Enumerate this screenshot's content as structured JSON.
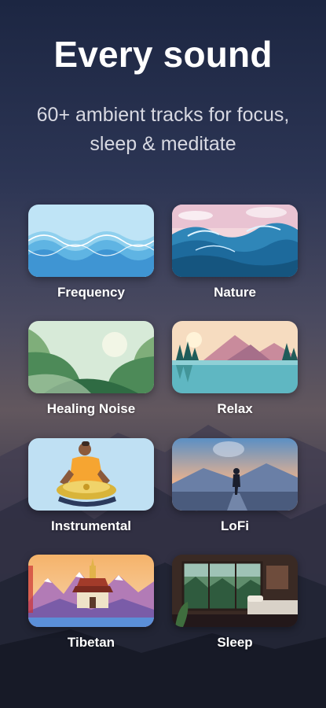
{
  "header": {
    "title": "Every sound",
    "subtitle_line1": "60+ ambient tracks for focus,",
    "subtitle_line2": "sleep & meditate"
  },
  "categories": [
    {
      "label": "Frequency",
      "icon": "wave-pattern"
    },
    {
      "label": "Nature",
      "icon": "ocean-waves"
    },
    {
      "label": "Healing Noise",
      "icon": "green-hills"
    },
    {
      "label": "Relax",
      "icon": "lake-sunset"
    },
    {
      "label": "Instrumental",
      "icon": "handpan-player"
    },
    {
      "label": "LoFi",
      "icon": "walking-figure"
    },
    {
      "label": "Tibetan",
      "icon": "stupa-mountains"
    },
    {
      "label": "Sleep",
      "icon": "bedroom-window"
    }
  ]
}
